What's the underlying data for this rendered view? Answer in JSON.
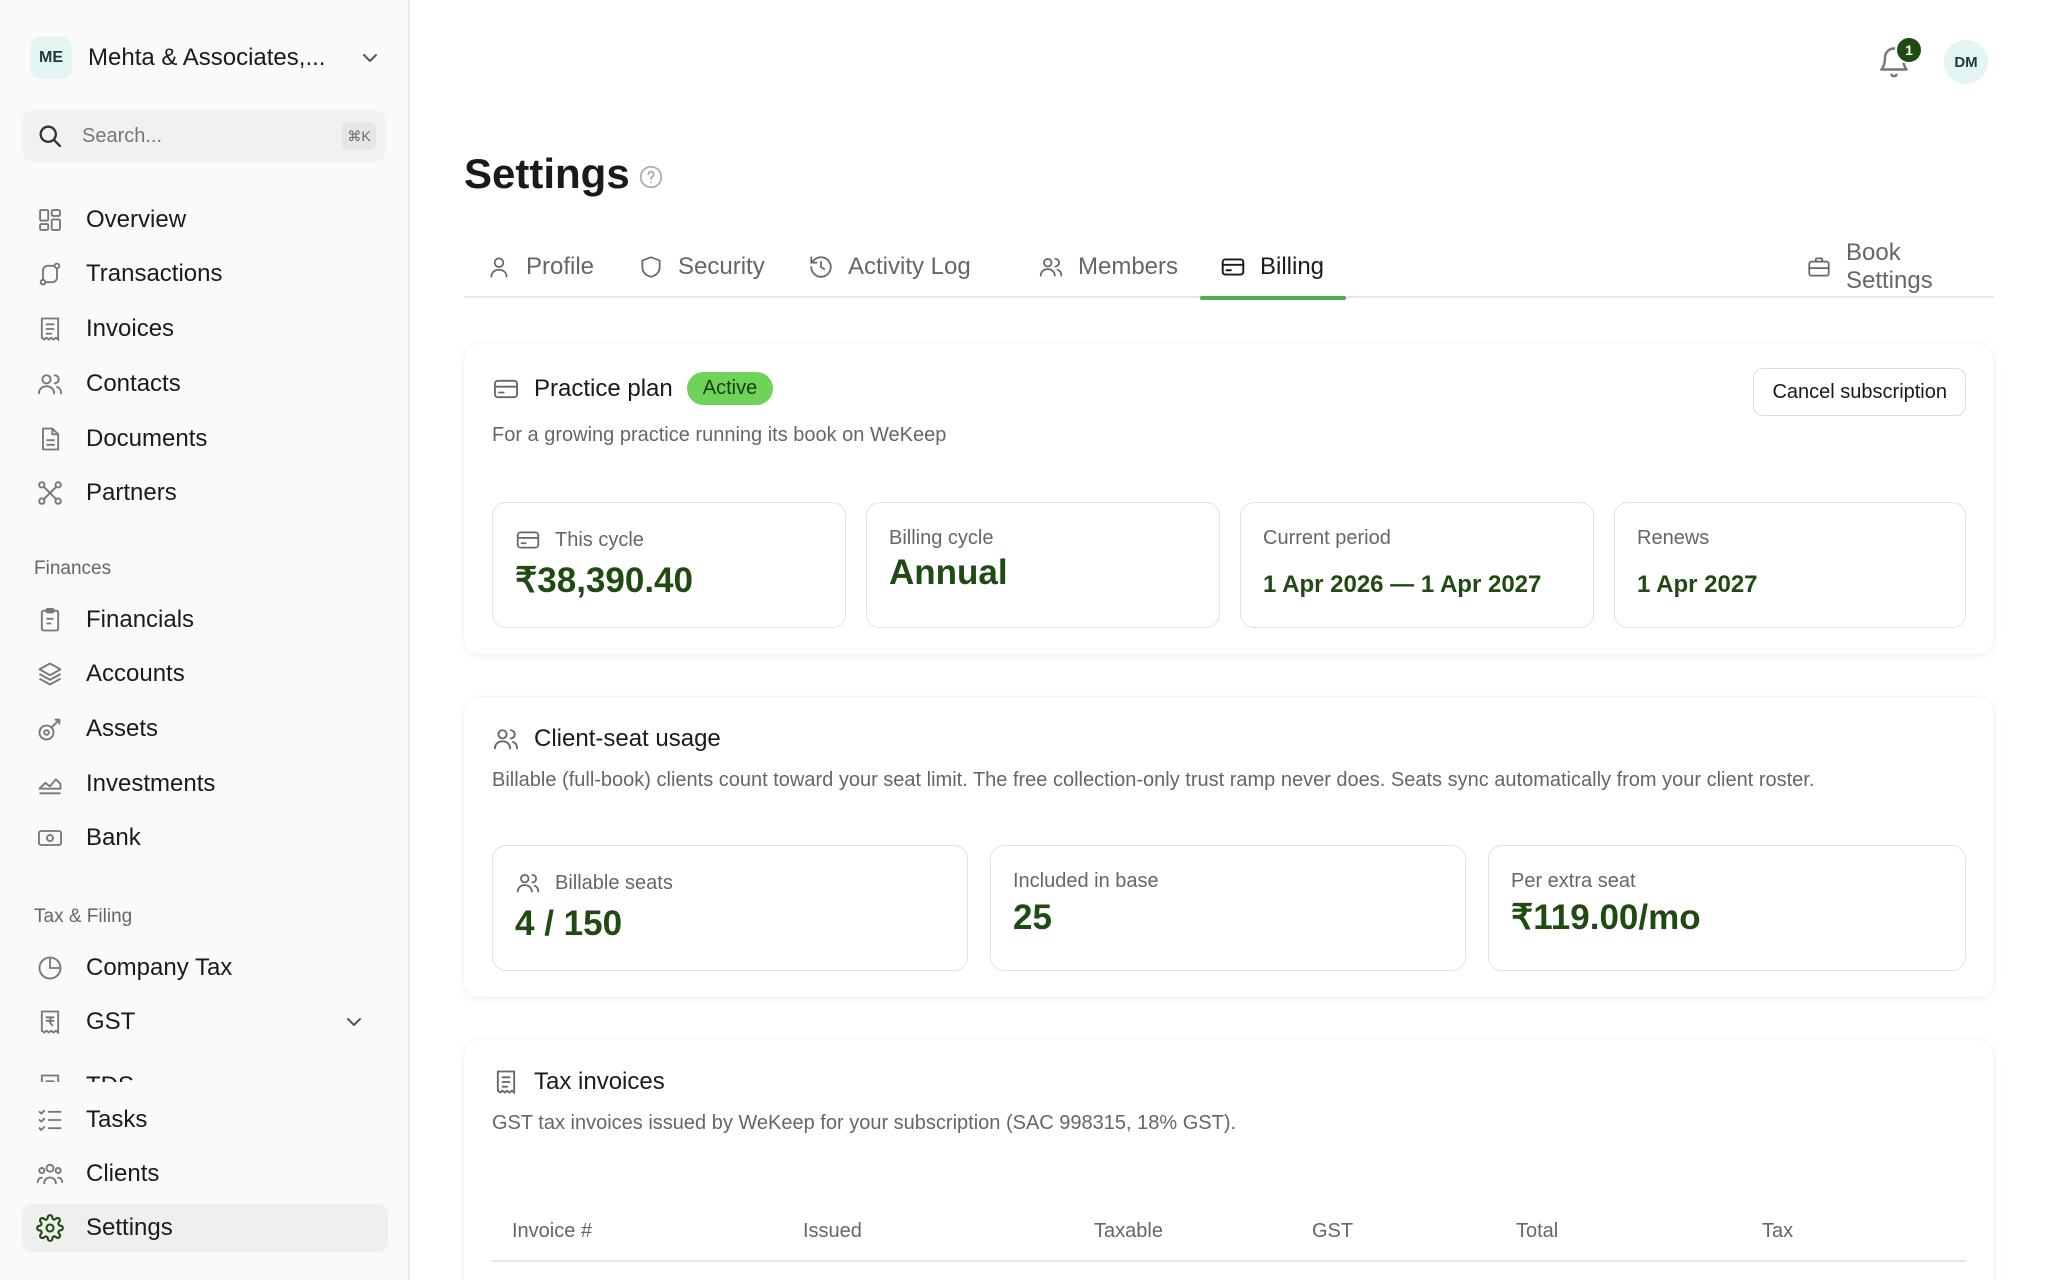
{
  "sidebar": {
    "org": {
      "initials": "ME",
      "name": "Mehta & Associates,..."
    },
    "search": {
      "placeholder": "Search...",
      "shortcut": "⌘K"
    },
    "nav": [
      {
        "label": "Overview"
      },
      {
        "label": "Transactions"
      },
      {
        "label": "Invoices"
      },
      {
        "label": "Contacts"
      },
      {
        "label": "Documents"
      },
      {
        "label": "Partners"
      }
    ],
    "finances": {
      "label": "Finances",
      "items": [
        {
          "label": "Financials"
        },
        {
          "label": "Accounts"
        },
        {
          "label": "Assets"
        },
        {
          "label": "Investments"
        },
        {
          "label": "Bank"
        }
      ]
    },
    "tax": {
      "label": "Tax & Filing",
      "items": [
        {
          "label": "Company Tax"
        },
        {
          "label": "GST"
        },
        {
          "label": "TDS"
        }
      ]
    },
    "bottom": [
      {
        "label": "Tasks"
      },
      {
        "label": "Clients"
      },
      {
        "label": "Settings"
      }
    ]
  },
  "header": {
    "notification_count": "1",
    "user_initials": "DM"
  },
  "page": {
    "title": "Settings",
    "tabs": [
      {
        "label": "Profile"
      },
      {
        "label": "Security"
      },
      {
        "label": "Activity Log"
      },
      {
        "label": "Members"
      },
      {
        "label": "Billing"
      },
      {
        "label": "Book Settings"
      }
    ],
    "active_tab": "Billing"
  },
  "plan": {
    "title": "Practice plan",
    "status": "Active",
    "description": "For a growing practice running its book on WeKeep",
    "cancel_label": "Cancel subscription",
    "stats": [
      {
        "label": "This cycle",
        "value": "₹38,390.40"
      },
      {
        "label": "Billing cycle",
        "value": "Annual"
      },
      {
        "label": "Current period",
        "value": "1 Apr 2026 — 1 Apr 2027"
      },
      {
        "label": "Renews",
        "value": "1 Apr 2027"
      }
    ]
  },
  "seats": {
    "title": "Client-seat usage",
    "description": "Billable (full-book) clients count toward your seat limit. The free collection-only trust ramp never does. Seats sync automatically from your client roster.",
    "stats": [
      {
        "label": "Billable seats",
        "value": "4 / 150"
      },
      {
        "label": "Included in base",
        "value": "25"
      },
      {
        "label": "Per extra seat",
        "value": "₹119.00/mo"
      }
    ]
  },
  "invoices": {
    "title": "Tax invoices",
    "description": "GST tax invoices issued by WeKeep for your subscription (SAC 998315, 18% GST).",
    "columns": [
      "Invoice #",
      "Issued",
      "Taxable",
      "GST",
      "Total",
      "Tax"
    ]
  },
  "colors": {
    "accent_green": "#4caf50",
    "active_badge": "#6fd35a",
    "value_green": "#1f4a12",
    "org_badge_bg": "#e3f6f3"
  }
}
